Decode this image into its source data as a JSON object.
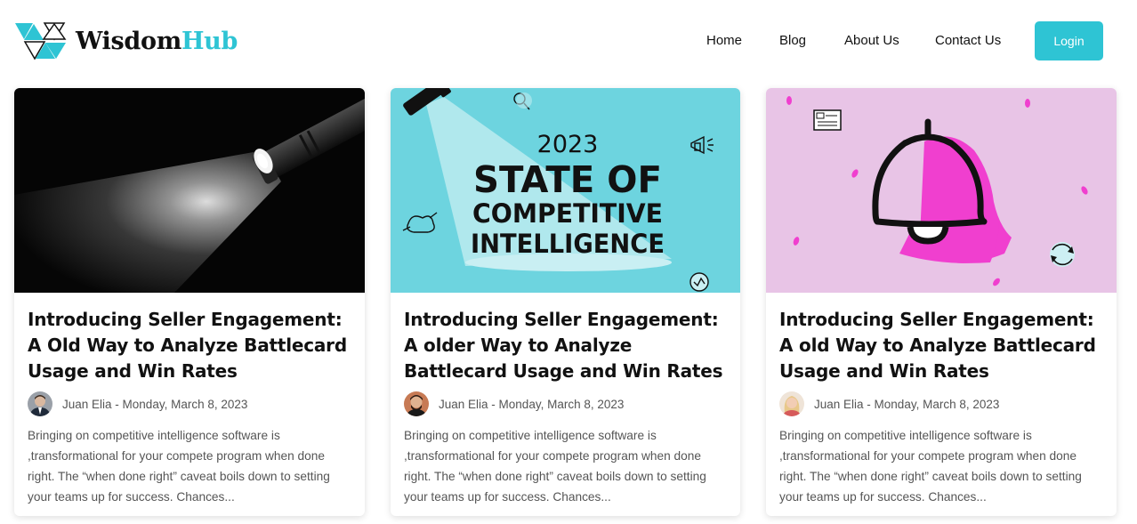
{
  "brand": {
    "name_part1": "Wisdom",
    "name_part2": "Hub",
    "accent_color": "#2ec4d4"
  },
  "nav": {
    "items": [
      {
        "label": "Home"
      },
      {
        "label": "Blog"
      },
      {
        "label": "About Us"
      },
      {
        "label": "Contact Us"
      }
    ],
    "login_label": "Login"
  },
  "cards": [
    {
      "image": "flashlight-photo",
      "title": "Introducing Seller Engagement: A Old Way to Analyze Battlecard Usage and Win Rates",
      "author": "Juan Elia",
      "date_separator": " - ",
      "date": "Monday, March 8, 2023",
      "excerpt": "Bringing on competitive intelligence software is ,transformational for your compete program when done right. The “when done right” caveat boils down to setting your teams up for success. Chances..."
    },
    {
      "image": "state-of-ci-banner",
      "image_text": {
        "year": "2023",
        "line1": "STATE OF",
        "line2": "COMPETITIVE",
        "line3": "INTELLIGENCE"
      },
      "title": "Introducing Seller Engagement: A older Way to Analyze Battlecard Usage and Win Rates",
      "author": "Juan Elia",
      "date_separator": " - ",
      "date": "Monday, March 8, 2023",
      "excerpt": "Bringing on competitive intelligence software is ,transformational for your compete program when done right. The “when done right” caveat boils down to setting your teams up for success. Chances..."
    },
    {
      "image": "bell-illustration",
      "title": "Introducing Seller Engagement: A old Way to Analyze Battlecard Usage and Win Rates",
      "author": "Juan Elia",
      "date_separator": " - ",
      "date": "Monday, March 8, 2023",
      "excerpt": "Bringing on competitive intelligence software is ,transformational for your compete program when done right. The “when done right” caveat boils down to setting your teams up for success. Chances..."
    }
  ]
}
